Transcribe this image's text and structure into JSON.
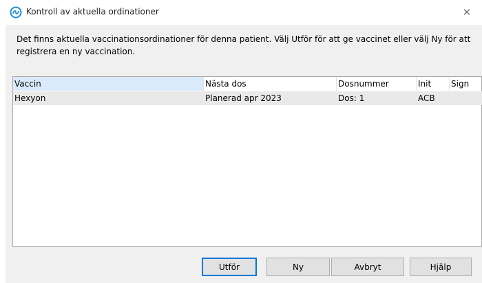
{
  "window": {
    "title": "Kontroll av aktuella ordinationer",
    "close_glyph": "✕",
    "icon": "app-logo-icon"
  },
  "message": "Det finns aktuella vaccinationsordinationer för denna patient. Välj Utför för att ge vaccinet eller välj Ny för att registrera en ny vaccination.",
  "table": {
    "columns": [
      "Vaccin",
      "Nästa dos",
      "Dosnummer",
      "Init",
      "Sign"
    ],
    "rows": [
      [
        "Hexyon",
        "Planerad apr 2023",
        "Dos: 1",
        "ACB",
        ""
      ]
    ]
  },
  "buttons": {
    "execute": "Utför",
    "new": "Ny",
    "cancel": "Avbryt",
    "help": "Hjälp"
  },
  "colors": {
    "accent": "#0078d7",
    "selected_header": "#d9ebfb",
    "row_highlight": "#e9e9e9",
    "dialog_bg": "#f0f0f0"
  }
}
